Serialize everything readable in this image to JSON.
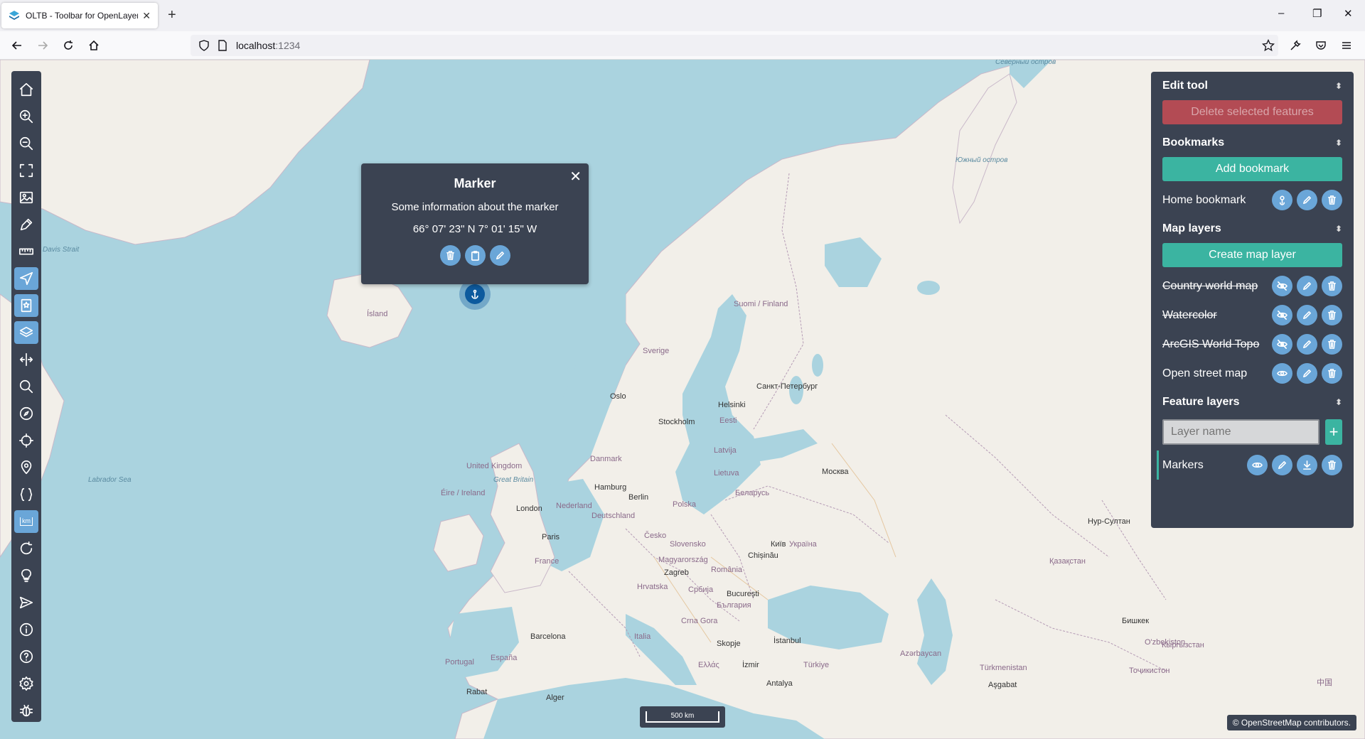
{
  "browser": {
    "tab_title": "OLTB - Toolbar for OpenLayers",
    "tab_close": "✕",
    "new_tab": "+",
    "url_host": "localhost",
    "url_port": ":1234",
    "win_minimize": "–",
    "win_restore": "❐",
    "win_close": "✕"
  },
  "popup": {
    "title": "Marker",
    "info": "Some information about the marker",
    "coordinates": "66° 07' 23\" N 7° 01' 15\" W",
    "close": "✕"
  },
  "panel": {
    "edit_tool": {
      "title": "Edit tool",
      "delete_label": "Delete selected features"
    },
    "bookmarks": {
      "title": "Bookmarks",
      "add_label": "Add bookmark",
      "items": [
        {
          "label": "Home bookmark"
        }
      ]
    },
    "map_layers": {
      "title": "Map layers",
      "create_label": "Create map layer",
      "items": [
        {
          "label": "Country world map",
          "visible": false
        },
        {
          "label": "Watercolor",
          "visible": false
        },
        {
          "label": "ArcGIS World Topo",
          "visible": false
        },
        {
          "label": "Open street map",
          "visible": true
        }
      ]
    },
    "feature_layers": {
      "title": "Feature layers",
      "input_placeholder": "Layer name",
      "add_symbol": "+",
      "items": [
        {
          "label": "Markers"
        }
      ]
    }
  },
  "scale": {
    "label": "500 km"
  },
  "attribution": "© OpenStreetMap contributors.",
  "map_labels": [
    "Davis Strait",
    "Ísland",
    "Labrador Sea",
    "Sverige",
    "Suomi / Finland",
    "Oslo",
    "Stockholm",
    "Helsinki",
    "Санкт-Петербург",
    "Eesti",
    "Latvija",
    "Lietuva",
    "Беларусь",
    "Москва",
    "Danmark",
    "United Kingdom",
    "Great Britain",
    "Éire / Ireland",
    "London",
    "Nederland",
    "Hamburg",
    "Berlin",
    "Deutschland",
    "Polska",
    "Česko",
    "Paris",
    "France",
    "Slovensko",
    "Magyarország",
    "Zagreb",
    "Hrvatska",
    "România",
    "Україна",
    "Київ",
    "Chișinău",
    "Србија",
    "București",
    "България",
    "İstanbul",
    "Italia",
    "Barcelona",
    "España",
    "Portugal",
    "Ελλάς",
    "İzmir",
    "Türkiye",
    "Antalya",
    "Қазақстан",
    "Нур-Султан",
    "Azərbaycan",
    "Türkmenistan",
    "O'zbekiston",
    "Кыргызстан",
    "Бишкек",
    "Тоҷикистон",
    "Aşgabat",
    "Rabat",
    "Alger",
    "中国",
    "Южный остров",
    "Северный остров",
    "Skopje",
    "Crna Gora"
  ],
  "colors": {
    "panel_bg": "#3b4352",
    "accent_green": "#3bb4a1",
    "accent_blue": "#6aa6d8",
    "danger": "#b34b54",
    "sea": "#aad3df",
    "land": "#f2efe9"
  },
  "toolbar_icons": [
    "home-icon",
    "zoom-in-icon",
    "zoom-out-icon",
    "fullscreen-icon",
    "image-export-icon",
    "draw-icon",
    "measure-icon",
    "edit-icon",
    "bookmark-icon",
    "layers-icon",
    "split-view-icon",
    "search-icon",
    "compass-icon",
    "crosshair-icon",
    "marker-icon",
    "code-icon",
    "scale-icon",
    "refresh-icon",
    "lightbulb-icon",
    "magnify-send-icon",
    "info-icon",
    "help-icon",
    "settings-icon",
    "debug-icon"
  ]
}
